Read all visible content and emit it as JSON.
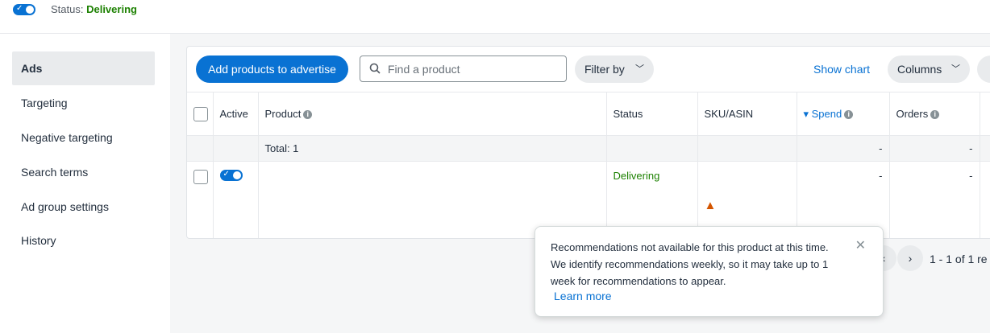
{
  "header": {
    "status_label": "Status:",
    "status_value": "Delivering"
  },
  "sidebar": {
    "items": [
      {
        "label": "Ads",
        "active": true
      },
      {
        "label": "Targeting"
      },
      {
        "label": "Negative targeting"
      },
      {
        "label": "Search terms"
      },
      {
        "label": "Ad group settings"
      },
      {
        "label": "History"
      }
    ]
  },
  "toolbar": {
    "add_label": "Add products to advertise",
    "search_placeholder": "Find a product",
    "filter_label": "Filter by",
    "show_chart_label": "Show chart",
    "columns_label": "Columns"
  },
  "table": {
    "headers": {
      "active": "Active",
      "product": "Product",
      "status": "Status",
      "sku": "SKU/ASIN",
      "spend": "Spend",
      "orders": "Orders"
    },
    "total": {
      "label": "Total: 1",
      "spend": "-",
      "orders": "-"
    },
    "rows": [
      {
        "status": "Delivering",
        "spend": "-",
        "orders": "-"
      }
    ]
  },
  "popover": {
    "message": "Recommendations not available for this product at this time. We identify recommendations weekly, so it may take up to 1 week for recommendations to appear.",
    "link": "Learn more"
  },
  "pagination": {
    "text": "1 - 1 of 1 re"
  },
  "colors": {
    "primary": "#0972d3",
    "success": "#1d8102",
    "warning": "#d45500"
  }
}
